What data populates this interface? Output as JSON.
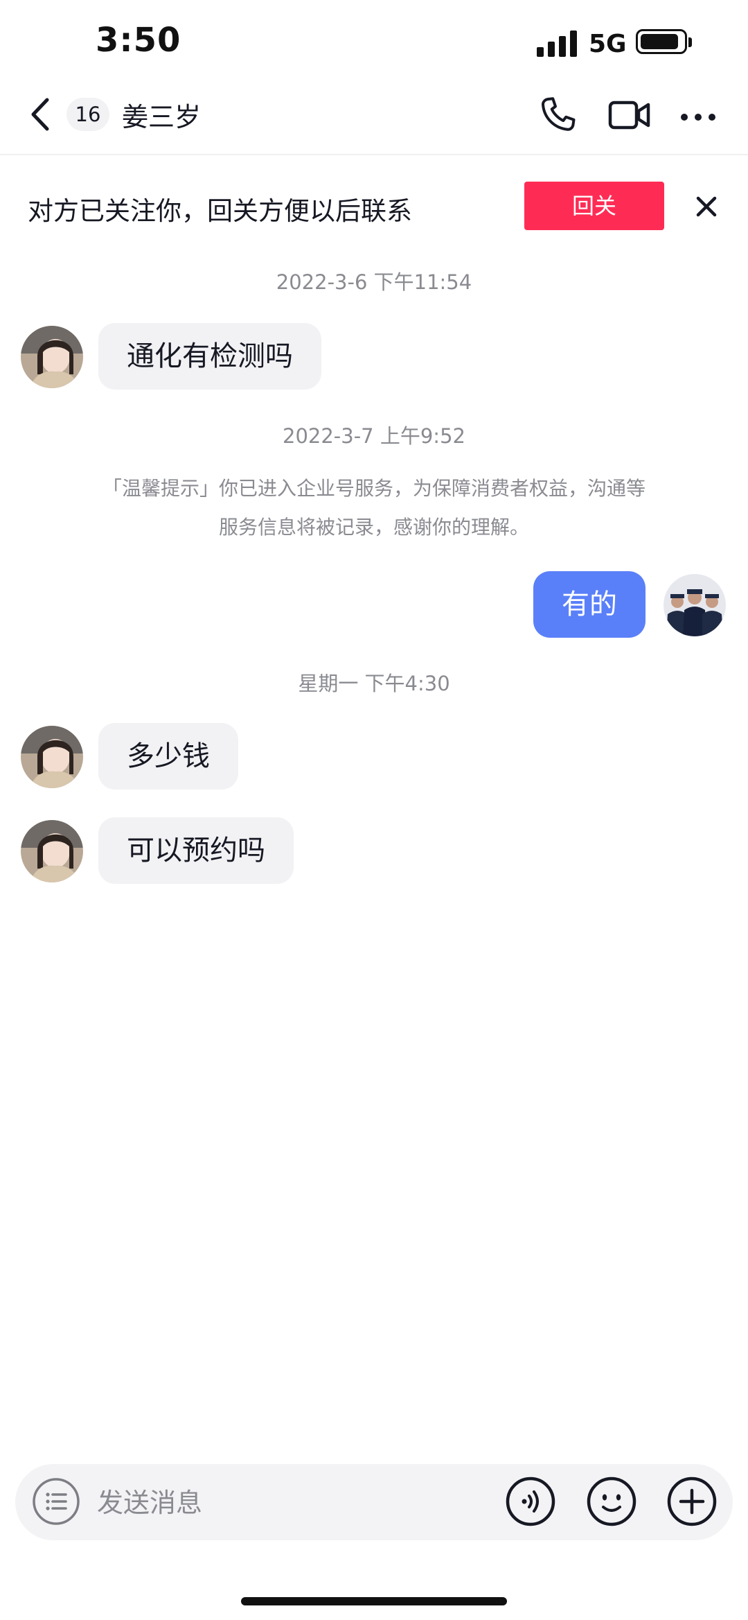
{
  "status_bar": {
    "time": "3:50",
    "network": "5G",
    "battery_level": 0.9,
    "icons": [
      "signal-bars-icon",
      "battery-icon"
    ]
  },
  "header": {
    "back_icon": "chevron-left-icon",
    "unread_count": "16",
    "title": "姜三岁",
    "actions": [
      "phone-icon",
      "video-camera-icon",
      "more-dots-icon"
    ]
  },
  "follow_banner": {
    "text": "对方已关注你，回关方便以后联系",
    "button_label": "回关",
    "button_color": "#fe2c55",
    "close_icon": "close-icon"
  },
  "messages": {
    "ts1": "2022-3-6 下午11:54",
    "m1": "通化有检测吗",
    "ts2": "2022-3-7 上午9:52",
    "notice_line1": "「温馨提示」你已进入企业号服务，为保障消费者权益，沟通等",
    "notice_line2": "服务信息将被记录，感谢你的理解。",
    "m2": "有的",
    "ts3": "星期一 下午4:30",
    "m3": "多少钱",
    "m4": "可以预约吗"
  },
  "colors": {
    "outgoing_bubble": "#5a80f9",
    "incoming_bubble": "#f2f2f4",
    "accent": "#fe2c55"
  },
  "input_bar": {
    "placeholder": "发送消息",
    "icons": [
      "list-menu-icon",
      "voice-icon",
      "emoji-icon",
      "plus-icon"
    ]
  }
}
